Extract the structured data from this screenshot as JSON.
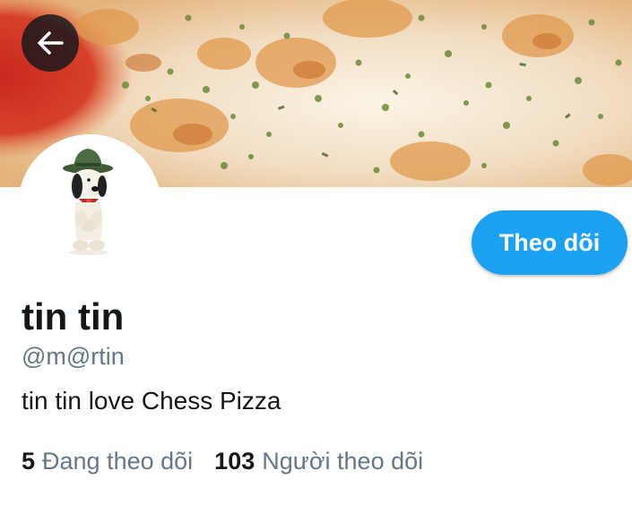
{
  "header": {
    "back_icon": "arrow-left-icon"
  },
  "profile": {
    "banner_image": "pizza-cheese-banner",
    "avatar_image": "snoopy-scout-figurine",
    "display_name": "tin tin",
    "handle": "@m@rtin",
    "bio": "tin tin love Chess Pizza",
    "follow_label": "Theo dõi",
    "following_count": "5",
    "following_label": "Đang theo dõi",
    "followers_count": "103",
    "followers_label": "Người theo dõi"
  },
  "colors": {
    "accent": "#1da1f2",
    "primary_text": "#14171a",
    "secondary_text": "#657786"
  }
}
